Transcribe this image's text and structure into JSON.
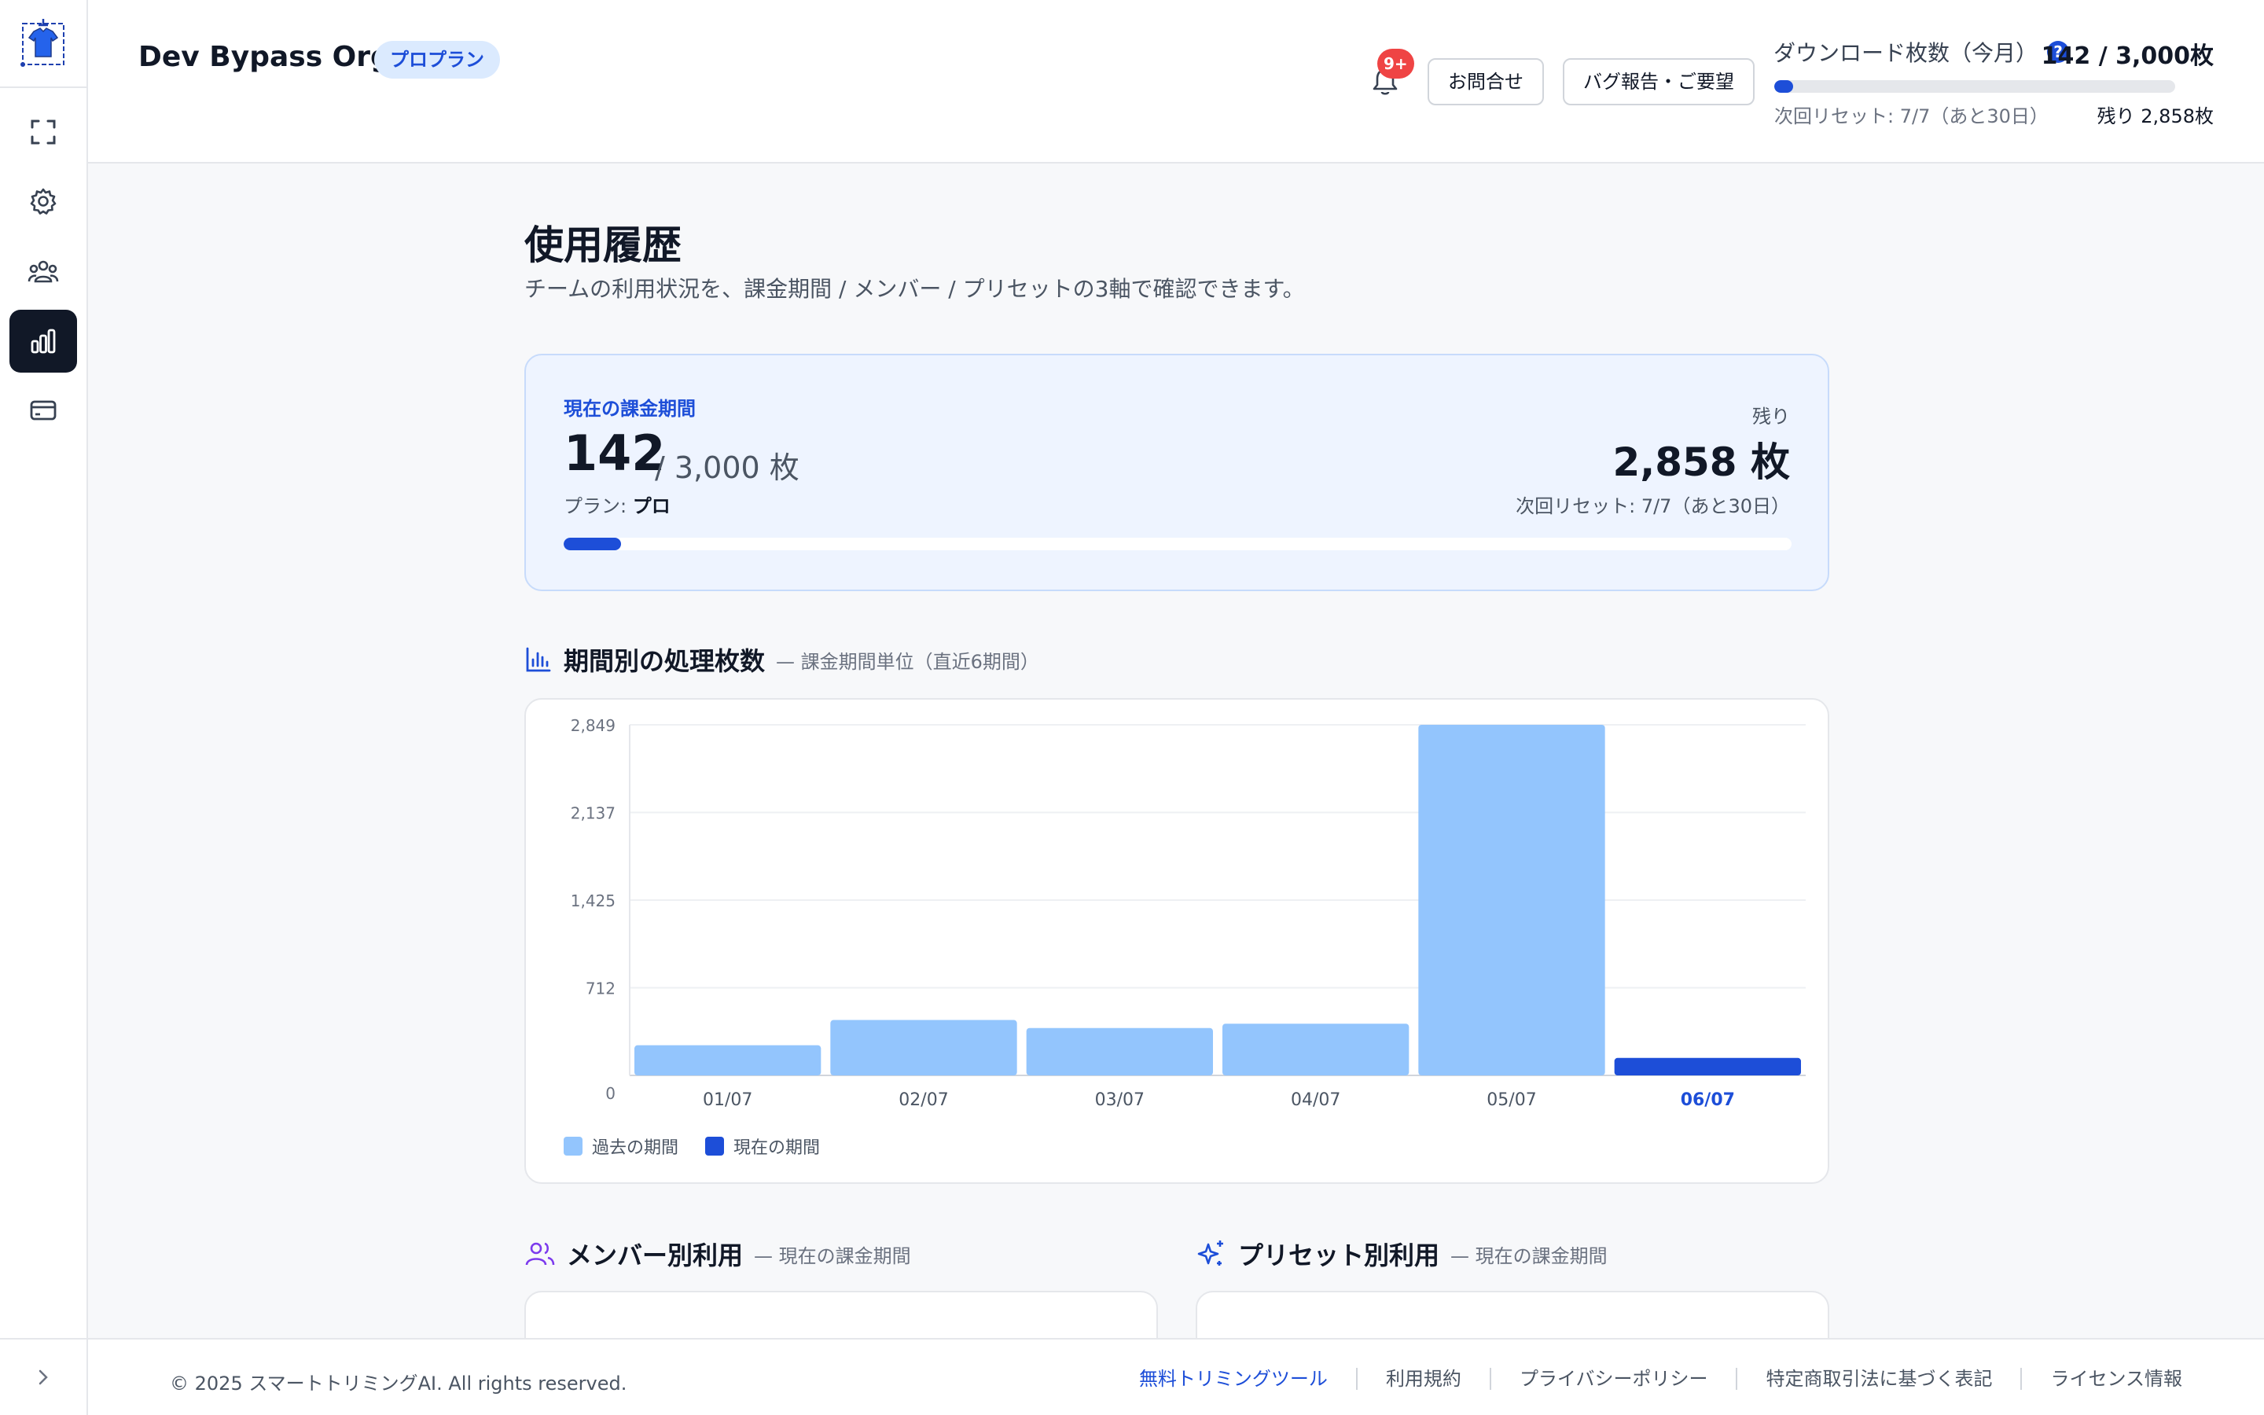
{
  "header": {
    "org_name": "Dev Bypass Org",
    "plan_badge": "プロプラン",
    "notification_badge": "9+",
    "contact_button": "お問合せ",
    "feedback_button": "バグ報告・ご要望",
    "downloads": {
      "title": "ダウンロード枚数（今月）",
      "help": "?",
      "count": "142 / 3,000枚",
      "used": 142,
      "limit": 3000,
      "reset": "次回リセット: 7/7（あと30日）",
      "remaining": "残り 2,858枚"
    }
  },
  "sidebar": {
    "items": [
      {
        "name": "crop",
        "icon": "frame-corners-icon"
      },
      {
        "name": "settings",
        "icon": "gear-icon"
      },
      {
        "name": "team",
        "icon": "users-icon"
      },
      {
        "name": "usage",
        "icon": "bar-chart-icon",
        "active": true
      },
      {
        "name": "billing",
        "icon": "credit-card-icon"
      }
    ]
  },
  "page": {
    "title": "使用履歴",
    "subtitle": "チームの利用状況を、課金期間 / メンバー / プリセットの3軸で確認できます。"
  },
  "summary": {
    "label": "現在の課金期間",
    "used": "142",
    "total": "/ 3,000 枚",
    "plan_label": "プラン: ",
    "plan_value": "プロ",
    "remaining_label": "残り",
    "remaining": "2,858 枚",
    "reset": "次回リセット: 7/7（あと30日）",
    "progress_fraction": 0.047
  },
  "period_section": {
    "title": "期間別の処理枚数",
    "subtitle": "— 課金期間単位（直近6期間）"
  },
  "chart_data": {
    "type": "bar",
    "categories": [
      "01/07",
      "02/07",
      "03/07",
      "04/07",
      "05/07",
      "06/07"
    ],
    "series": [
      {
        "name": "過去の期間",
        "values": [
          245,
          450,
          385,
          420,
          2849,
          0
        ]
      },
      {
        "name": "現在の期間",
        "values": [
          0,
          0,
          0,
          0,
          0,
          142
        ]
      }
    ],
    "values": [
      245,
      450,
      385,
      420,
      2849,
      142
    ],
    "current_index": 5,
    "yticks": [
      "0",
      "712",
      "1,425",
      "2,137",
      "2,849"
    ],
    "ylim": [
      0,
      2849
    ],
    "colors": {
      "past": "#93c5fd",
      "current": "#1d4ed8"
    },
    "grid": true,
    "legend": "bottom-left"
  },
  "member_section": {
    "title": "メンバー別利用",
    "subtitle": "— 現在の課金期間"
  },
  "preset_section": {
    "title": "プリセット別利用",
    "subtitle": "— 現在の課金期間"
  },
  "footer": {
    "copyright": "© 2025 スマートトリミングAI. All rights reserved.",
    "links": [
      "無料トリミングツール",
      "利用規約",
      "プライバシーポリシー",
      "特定商取引法に基づく表記",
      "ライセンス情報"
    ]
  },
  "colors": {
    "accent": "#1d4ed8",
    "bar_past": "#93c5fd",
    "badge": "#ef4444"
  }
}
